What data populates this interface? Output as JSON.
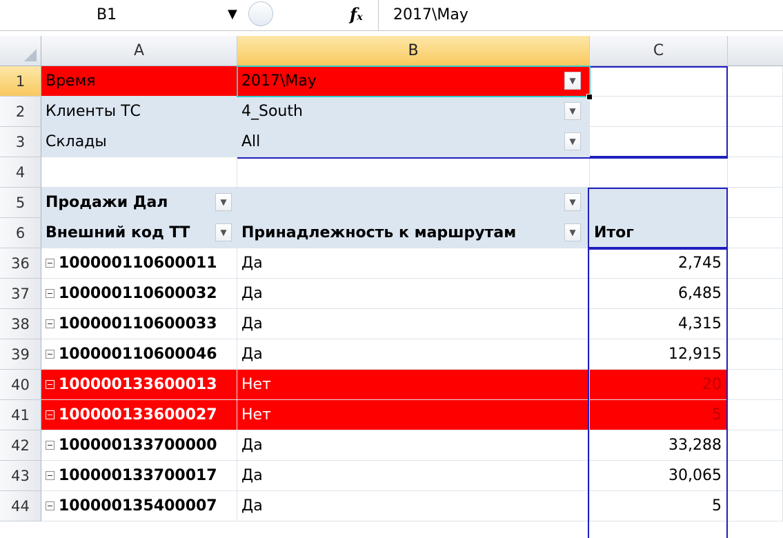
{
  "formula_bar": {
    "name_box": "B1",
    "fx_label": "fx",
    "formula": "2017\\May"
  },
  "columns": [
    "A",
    "B",
    "C"
  ],
  "filters": [
    {
      "row": "1",
      "label": "Время",
      "value": "2017\\May"
    },
    {
      "row": "2",
      "label": "Клиенты ТС",
      "value": "4_South"
    },
    {
      "row": "3",
      "label": "Склады",
      "value": "All"
    }
  ],
  "empty_row": "4",
  "pivot_header": {
    "row5": {
      "row": "5",
      "label": "Продажи Дал"
    },
    "row6": {
      "row": "6",
      "col_a": "Внешний код ТТ",
      "col_b": "Принадлежность к маршрутам",
      "col_c": "Итог"
    }
  },
  "rows": [
    {
      "row": "36",
      "code": "100000110600011",
      "belong": "Да",
      "total": "2,745",
      "highlight": false
    },
    {
      "row": "37",
      "code": "100000110600032",
      "belong": "Да",
      "total": "6,485",
      "highlight": false
    },
    {
      "row": "38",
      "code": "100000110600033",
      "belong": "Да",
      "total": "4,315",
      "highlight": false
    },
    {
      "row": "39",
      "code": "100000110600046",
      "belong": "Да",
      "total": "12,915",
      "highlight": false
    },
    {
      "row": "40",
      "code": "100000133600013",
      "belong": "Нет",
      "total": "20",
      "highlight": true
    },
    {
      "row": "41",
      "code": "100000133600027",
      "belong": "Нет",
      "total": "5",
      "highlight": true
    },
    {
      "row": "42",
      "code": "100000133700000",
      "belong": "Да",
      "total": "33,288",
      "highlight": false
    },
    {
      "row": "43",
      "code": "100000133700017",
      "belong": "Да",
      "total": "30,065",
      "highlight": false
    },
    {
      "row": "44",
      "code": "100000135400007",
      "belong": "Да",
      "total": "5",
      "highlight": false
    }
  ],
  "colors": {
    "highlight": "#ff0000",
    "box": "#1f1fbf",
    "filter_bg": "#dce6f1"
  }
}
